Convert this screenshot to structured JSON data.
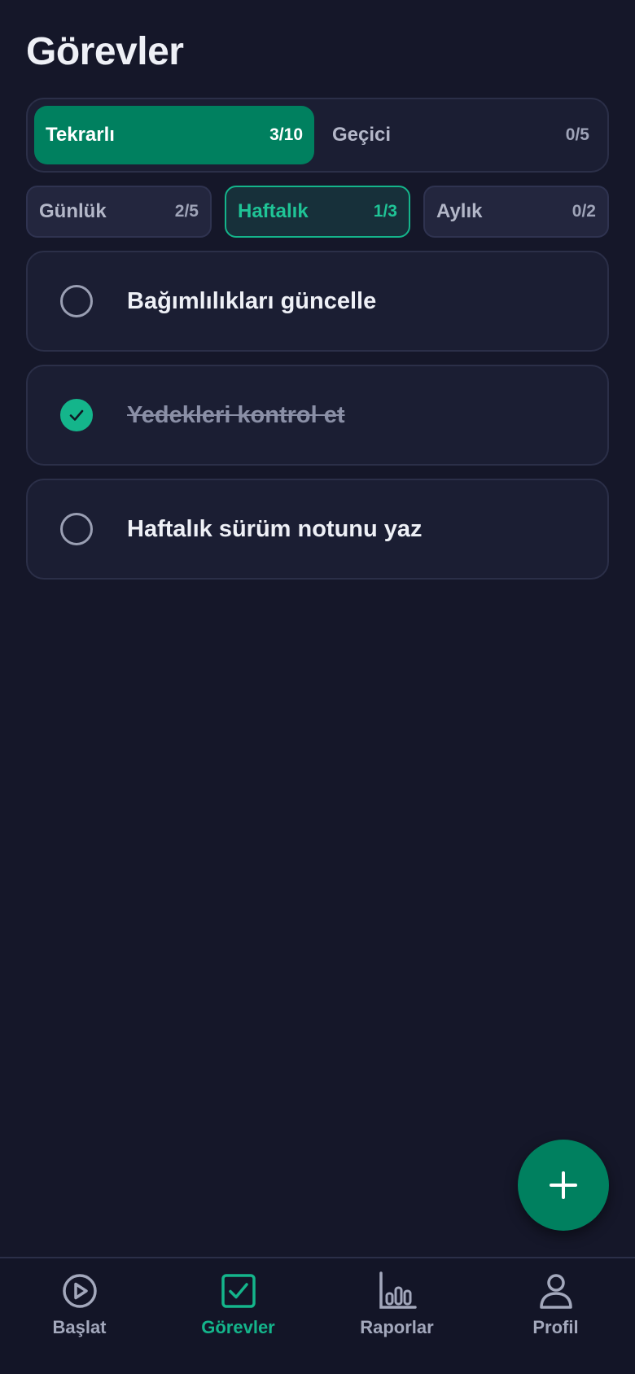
{
  "header": {
    "title": "Görevler"
  },
  "segments": [
    {
      "label": "Tekrarlı",
      "count": "3/10",
      "active": true
    },
    {
      "label": "Geçici",
      "count": "0/5",
      "active": false
    }
  ],
  "filters": [
    {
      "label": "Günlük",
      "count": "2/5",
      "active": false
    },
    {
      "label": "Haftalık",
      "count": "1/3",
      "active": true
    },
    {
      "label": "Aylık",
      "count": "0/2",
      "active": false
    }
  ],
  "tasks": [
    {
      "text": "Bağımlılıkları güncelle",
      "done": false
    },
    {
      "text": "Yedekleri kontrol et",
      "done": true
    },
    {
      "text": "Haftalık sürüm notunu yaz",
      "done": false
    }
  ],
  "fab": {
    "icon": "plus-icon"
  },
  "nav": [
    {
      "label": "Başlat",
      "icon": "play-circle-icon",
      "active": false
    },
    {
      "label": "Görevler",
      "icon": "checkbox-icon",
      "active": true
    },
    {
      "label": "Raporlar",
      "icon": "bar-chart-icon",
      "active": false
    },
    {
      "label": "Profil",
      "icon": "user-icon",
      "active": false
    }
  ],
  "colors": {
    "background": "#151729",
    "accent": "#00805f",
    "accent_bright": "#14b58b",
    "card": "#1b1e33"
  }
}
